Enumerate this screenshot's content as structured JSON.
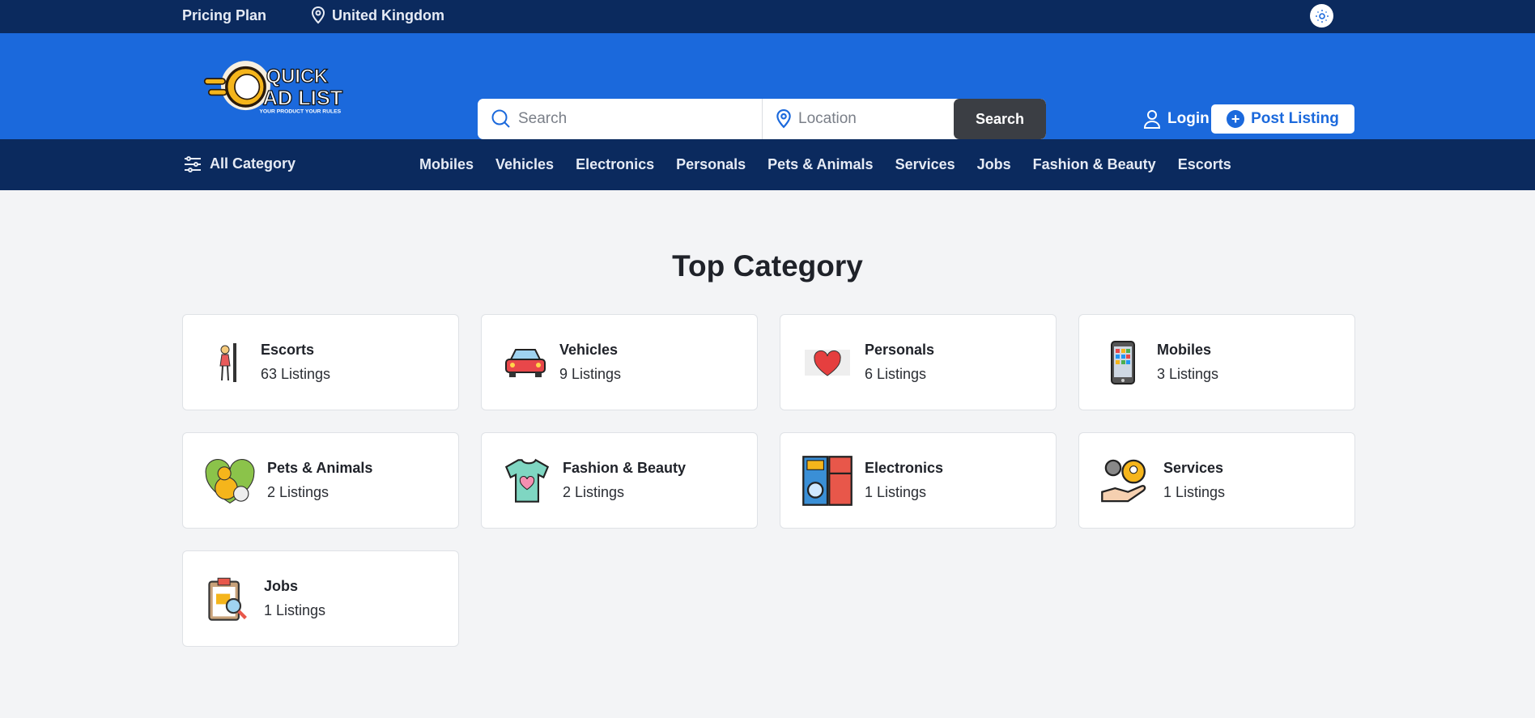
{
  "topbar": {
    "pricing": "Pricing Plan",
    "location": "United Kingdom"
  },
  "header": {
    "logo_text": "QUICK AD LIST",
    "logo_tagline": "YOUR PRODUCT YOUR RULES",
    "search_placeholder": "Search",
    "location_placeholder": "Location",
    "search_button": "Search",
    "login": "Login",
    "post_listing": "Post Listing"
  },
  "nav": {
    "all_category": "All Category",
    "items": [
      "Mobiles",
      "Vehicles",
      "Electronics",
      "Personals",
      "Pets & Animals",
      "Services",
      "Jobs",
      "Fashion & Beauty",
      "Escorts"
    ]
  },
  "main": {
    "title": "Top Category",
    "categories": [
      {
        "name": "Escorts",
        "count": "63 Listings",
        "icon": "escort-icon"
      },
      {
        "name": "Vehicles",
        "count": "9 Listings",
        "icon": "car-icon"
      },
      {
        "name": "Personals",
        "count": "6 Listings",
        "icon": "heart-icon"
      },
      {
        "name": "Mobiles",
        "count": "3 Listings",
        "icon": "phone-icon"
      },
      {
        "name": "Pets & Animals",
        "count": "2 Listings",
        "icon": "pets-icon"
      },
      {
        "name": "Fashion & Beauty",
        "count": "2 Listings",
        "icon": "tshirt-icon"
      },
      {
        "name": "Electronics",
        "count": "1 Listings",
        "icon": "appliances-icon"
      },
      {
        "name": "Services",
        "count": "1 Listings",
        "icon": "services-icon"
      },
      {
        "name": "Jobs",
        "count": "1 Listings",
        "icon": "jobs-icon"
      }
    ]
  },
  "colors": {
    "primary": "#1b69dc",
    "dark": "#0b2a5e",
    "button": "#3b3e44"
  }
}
